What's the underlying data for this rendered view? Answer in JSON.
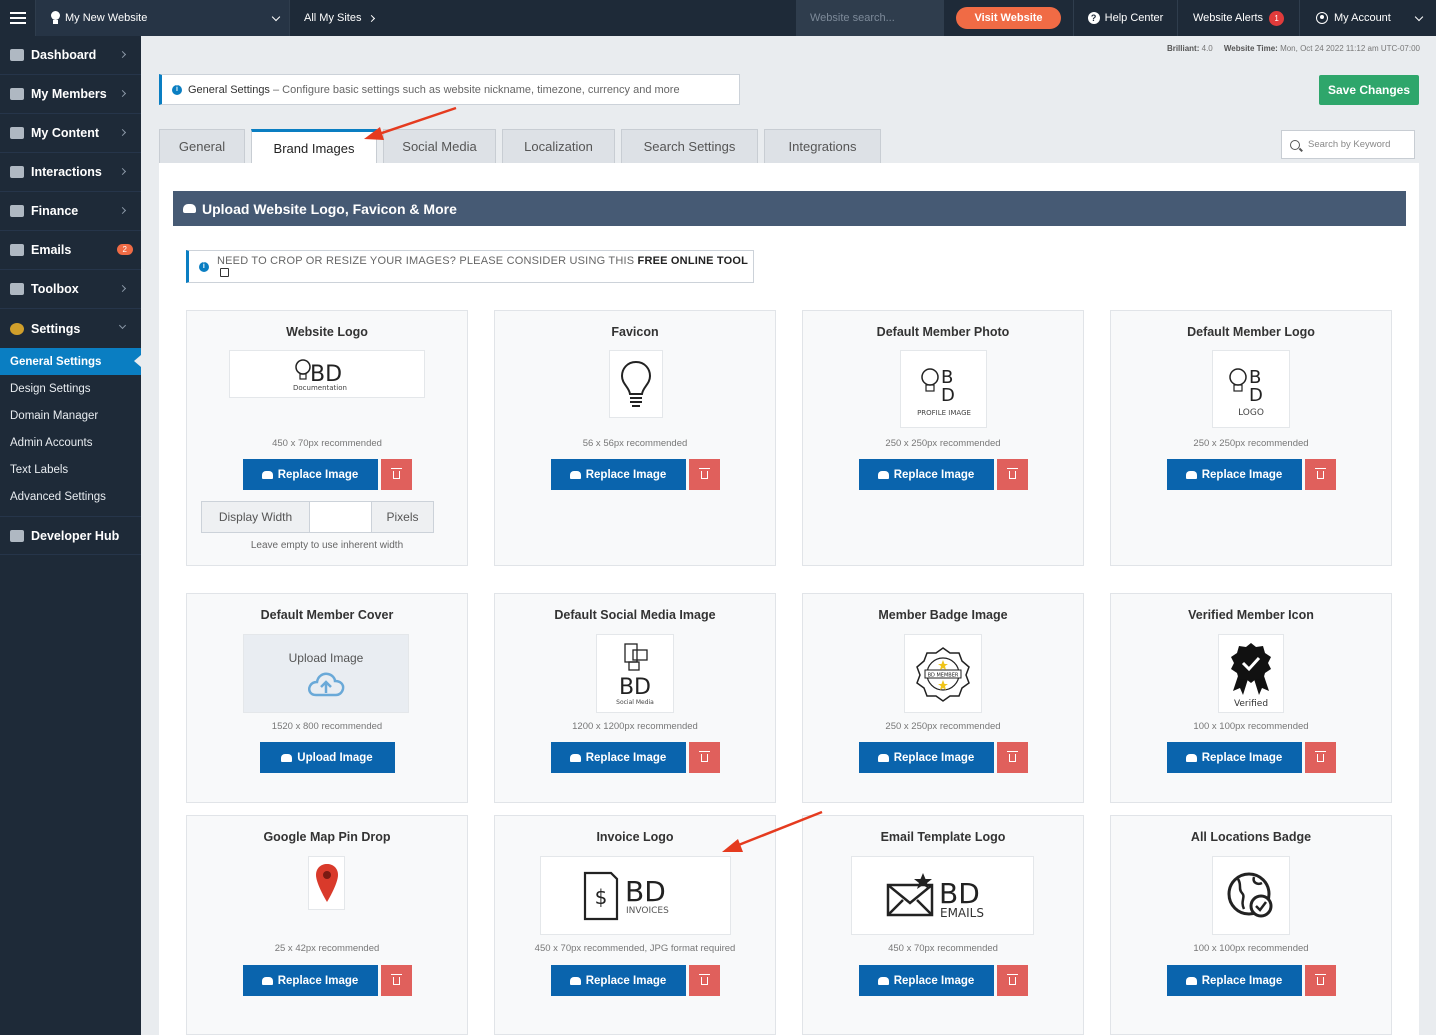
{
  "topbar": {
    "site_name": "My New Website",
    "all_sites": "All My Sites",
    "search_placeholder": "Website search...",
    "visit_website": "Visit Website",
    "help_center": "Help Center",
    "website_alerts": "Website Alerts",
    "alerts_count": "1",
    "my_account": "My Account"
  },
  "sidebar": {
    "items": [
      {
        "label": "Dashboard"
      },
      {
        "label": "My Members"
      },
      {
        "label": "My Content"
      },
      {
        "label": "Interactions"
      },
      {
        "label": "Finance"
      },
      {
        "label": "Emails",
        "count": "2"
      },
      {
        "label": "Toolbox"
      },
      {
        "label": "Settings"
      }
    ],
    "sub_items": [
      {
        "label": "General Settings"
      },
      {
        "label": "Design Settings"
      },
      {
        "label": "Domain Manager"
      },
      {
        "label": "Admin Accounts"
      },
      {
        "label": "Text Labels"
      },
      {
        "label": "Advanced Settings"
      }
    ],
    "developer_hub": "Developer Hub"
  },
  "meta": {
    "brilliant_label": "Brilliant:",
    "brilliant_value": "4.0",
    "time_label": "Website Time:",
    "time_value": "Mon, Oct 24 2022 11:12 am UTC-07:00"
  },
  "notice": {
    "title": "General Settings",
    "text": " – Configure basic settings such as website nickname, timezone, currency and more"
  },
  "save_changes": "Save Changes",
  "tabs": [
    {
      "label": "General"
    },
    {
      "label": "Brand Images"
    },
    {
      "label": "Social Media"
    },
    {
      "label": "Localization"
    },
    {
      "label": "Search Settings"
    },
    {
      "label": "Integrations"
    }
  ],
  "keyword_search_placeholder": "Search by Keyword",
  "section_title": "Upload Website Logo, Favicon & More",
  "tip": {
    "text": "NEED TO CROP OR RESIZE YOUR IMAGES? PLEASE CONSIDER USING THIS",
    "link": "FREE ONLINE TOOL"
  },
  "buttons": {
    "replace": "Replace Image",
    "upload": "Upload Image"
  },
  "display_width": {
    "label": "Display Width",
    "unit": "Pixels",
    "note": "Leave empty to use inherent width"
  },
  "cards": [
    {
      "title": "Website Logo",
      "rec": "450 x 70px recommended",
      "logo_big": "BD",
      "logo_small": "Documentation"
    },
    {
      "title": "Favicon",
      "rec": "56 x 56px recommended"
    },
    {
      "title": "Default Member Photo",
      "rec": "250 x 250px recommended",
      "logo_small": "PROFILE IMAGE"
    },
    {
      "title": "Default Member Logo",
      "rec": "250 x 250px recommended",
      "logo_small": "LOGO"
    },
    {
      "title": "Default Member Cover",
      "rec": "1520 x 800 recommended",
      "preview_text": "Upload Image"
    },
    {
      "title": "Default Social Media Image",
      "rec": "1200 x 1200px recommended",
      "logo_big": "BD",
      "logo_small": "Social Media"
    },
    {
      "title": "Member Badge Image",
      "rec": "250 x 250px recommended",
      "logo_small": "BD MEMBER"
    },
    {
      "title": "Verified Member Icon",
      "rec": "100 x 100px recommended",
      "logo_small": "Verified"
    },
    {
      "title": "Google Map Pin Drop",
      "rec": "25 x 42px recommended"
    },
    {
      "title": "Invoice Logo",
      "rec": "450 x 70px recommended, JPG format required",
      "logo_big": "BD",
      "logo_small": "INVOICES"
    },
    {
      "title": "Email Template Logo",
      "rec": "450 x 70px recommended",
      "logo_big": "BD",
      "logo_small": "EMAILS"
    },
    {
      "title": "All Locations Badge",
      "rec": "100 x 100px recommended"
    }
  ]
}
